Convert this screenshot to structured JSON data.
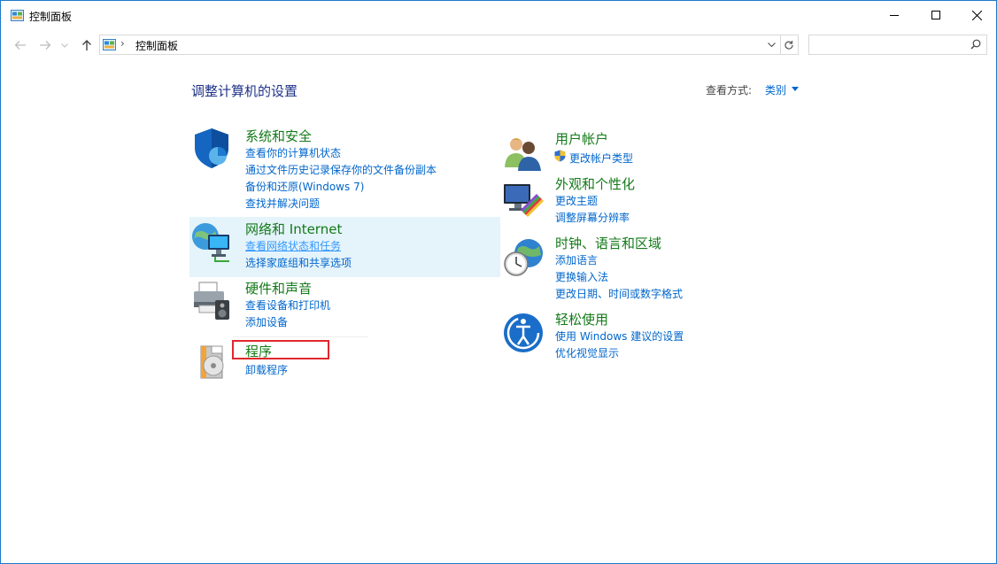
{
  "window": {
    "title": "控制面板",
    "minimize": "minimize",
    "maximize": "maximize",
    "close": "close"
  },
  "address": {
    "crumb": "控制面板",
    "search_placeholder": ""
  },
  "content": {
    "heading": "调整计算机的设置",
    "view_by_label": "查看方式:",
    "view_by_value": "类别"
  },
  "left": [
    {
      "title": "系统和安全",
      "icon": "shield-icon",
      "links": [
        "查看你的计算机状态",
        "通过文件历史记录保存你的文件备份副本",
        "备份和还原(Windows 7)",
        "查找并解决问题"
      ]
    },
    {
      "title": "网络和 Internet",
      "icon": "network-globe-icon",
      "links": [
        "查看网络状态和任务",
        "选择家庭组和共享选项"
      ]
    },
    {
      "title": "硬件和声音",
      "icon": "printer-icon",
      "links": [
        "查看设备和打印机",
        "添加设备"
      ]
    },
    {
      "title": "程序",
      "icon": "programs-disc-icon",
      "links": [
        "卸载程序"
      ]
    }
  ],
  "right": [
    {
      "title": "用户帐户",
      "icon": "users-icon",
      "links": [
        "更改帐户类型"
      ]
    },
    {
      "title": "外观和个性化",
      "icon": "monitor-color-icon",
      "links": [
        "更改主题",
        "调整屏幕分辨率"
      ]
    },
    {
      "title": "时钟、语言和区域",
      "icon": "clock-globe-icon",
      "links": [
        "添加语言",
        "更换输入法",
        "更改日期、时间或数字格式"
      ]
    },
    {
      "title": "轻松使用",
      "icon": "ease-of-access-icon",
      "links": [
        "使用 Windows 建议的设置",
        "优化视觉显示"
      ]
    }
  ],
  "colors": {
    "category_title": "#137a18",
    "link": "#0066cc",
    "heading": "#1e3287",
    "highlight": "#e5f3fb",
    "selection_box": "#e0272d"
  }
}
